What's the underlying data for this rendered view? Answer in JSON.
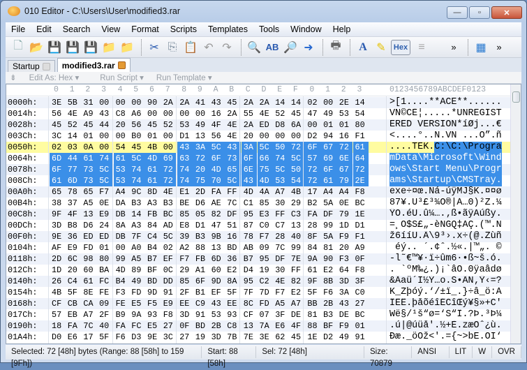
{
  "window": {
    "title": "010 Editor - C:\\Users\\User\\modified3.rar",
    "minimize": "—",
    "maximize": "▫",
    "close": "✕"
  },
  "menu": [
    "File",
    "Edit",
    "Search",
    "View",
    "Format",
    "Scripts",
    "Templates",
    "Tools",
    "Window",
    "Help"
  ],
  "toolbar": {
    "hex_label": "Hex",
    "more1": "»",
    "more2": "»"
  },
  "tabs": [
    {
      "label": "Startup"
    },
    {
      "label": "modified3.rar"
    }
  ],
  "subbar": {
    "edit_as": "Edit As: Hex ▾",
    "run_script": "Run Script ▾",
    "run_template": "Run Template ▾"
  },
  "header": {
    "hex_columns": [
      "0",
      "1",
      "2",
      "3",
      "4",
      "5",
      "6",
      "7",
      "8",
      "9",
      "A",
      "B",
      "C",
      "D",
      "E",
      "F",
      "0",
      "1",
      "2",
      "3"
    ],
    "ascii_columns": "0123456789ABCDEF0123"
  },
  "selection": {
    "start": 88,
    "end": 159,
    "cursor_row": 4
  },
  "rows": [
    {
      "addr": "0000h:",
      "hex": "3E 5B 31 00 00 00 90 2A 2A 41 43 45 2A 2A 14 14 02 00 2E 14",
      "ascii": ">[1....**ACE**......"
    },
    {
      "addr": "0014h:",
      "hex": "56 4E A9 43 C8 A6 00 00 00 00 16 2A 55 4E 52 45 47 49 53 54",
      "ascii": "VN©CÈ¦.....*UNREGIST"
    },
    {
      "addr": "0028h:",
      "hex": "45 52 45 44 20 56 45 52 53 49 4F 4E 2A ED D8 6A 00 01 01 80",
      "ascii": "ERED VERSION*íØj...€"
    },
    {
      "addr": "003Ch:",
      "hex": "3C 14 01 00 00 B0 01 00 D1 13 56 4E 20 00 00 00 D2 94 16 F1",
      "ascii": "<....°..Ñ.VN ...Ò”.ñ"
    },
    {
      "addr": "0050h:",
      "hex": "02 03 0A 00 54 45 4B 00 43 3A 5C 43 3A 5C 50 72 6F 67 72 61",
      "ascii": "....TEK.C:\\C:\\Progra"
    },
    {
      "addr": "0064h:",
      "hex": "6D 44 61 74 61 5C 4D 69 63 72 6F 73 6F 66 74 5C 57 69 6E 64",
      "ascii": "mData\\Microsoft\\Wind"
    },
    {
      "addr": "0078h:",
      "hex": "6F 77 73 5C 53 74 61 72 74 20 4D 65 6E 75 5C 50 72 6F 67 72",
      "ascii": "ows\\Start Menu\\Progr"
    },
    {
      "addr": "008Ch:",
      "hex": "61 6D 73 5C 53 74 61 72 74 75 70 5C 43 4D 53 54 72 61 79 2E",
      "ascii": "ams\\Startup\\CMSTray."
    },
    {
      "addr": "00A0h:",
      "hex": "65 78 65 F7 A4 9C 8D 4E E1 2D FA FF 4D 4A A7 4B 17 A4 A4 F8",
      "ascii": "exe÷¤œ.Ná-úÿMJ§K.¤¤ø"
    },
    {
      "addr": "00B4h:",
      "hex": "38 37 A5 0E DA B3 A3 B3 BE D6 AE 7C C1 85 30 29 B2 5A 0E BC",
      "ascii": "87¥.Ú³£³¾Ö®|Á…0)²Z.¼"
    },
    {
      "addr": "00C8h:",
      "hex": "9F 4F 13 E9 DB 14 FB BC 85 05 82 DF 95 E3 FF C3 FA DF 79 1E",
      "ascii": "ŸO.éÛ.û¼….‚ß•ãÿÃúßy."
    },
    {
      "addr": "00DCh:",
      "hex": "3D B8 D6 24 8A A3 84 AD E8 D1 47 51 87 C0 C7 13 28 99 1D D1",
      "ascii": "=¸Ö$Š£„-èÑGQ‡ÀÇ.(™.Ñ"
    },
    {
      "addr": "00F0h:",
      "hex": "9E 36 ED ED DB 7F C4 5C 39 B3 9B 16 78 F7 28 40 8F 5A F9 F1",
      "ascii": "ž6ííÛ.Ä\\9³›.x÷(@.Zùñ"
    },
    {
      "addr": "0104h:",
      "hex": "AF E9 FD 01 00 A0 B4 02 A2 88 13 BD AB 09 7C 99 84 81 20 A9",
      "ascii": "¯éý.. ´.¢ˆ.½«.|™„. ©"
    },
    {
      "addr": "0118h:",
      "hex": "2D 6C 98 80 99 A5 B7 EF F7 FB 6D 36 B7 95 DF 7E 9A 90 F3 0F",
      "ascii": "-l˜€™¥·ï÷ûm6·•ß~š.ó."
    },
    {
      "addr": "012Ch:",
      "hex": "1D 20 60 BA 4D 89 BF 0C 29 A1 60 E2 D4 19 30 FF 61 E2 64 F8",
      "ascii": ". `ºM‰¿.)¡`âÔ.0ÿaâdø"
    },
    {
      "addr": "0140h:",
      "hex": "26 C4 61 FC B4 49 BD DD 85 6F 9D 8A 95 C2 4E 82 9F 8B 3D 3F",
      "ascii": "&Äaü´I½Ý…o.Š•ÂN‚Ÿ‹=?"
    },
    {
      "addr": "0154h:",
      "hex": "4B 5F 8E FE F3 FD 9D 91 2F B1 EF 5F 7F 7D F7 E2 5F F6 3A C0",
      "ascii": "K_Žþóý.‘/±ï_.}÷â_ö:À"
    },
    {
      "addr": "0168h:",
      "hex": "CF CB CA 09 FE E5 F5 E9 EE C9 43 EE 8C FD A5 A7 BB 2B 43 27",
      "ascii": "ÏËÊ.þåõéîÉCîŒý¥§»+C'"
    },
    {
      "addr": "017Ch:",
      "hex": "57 EB A7 2F B9 9A 93 F8 3D 91 53 93 CF 07 3F DE 81 B3 DE BC",
      "ascii": "Wë§/¹š“ø=‘S“Ï.?Þ.³Þ¼"
    },
    {
      "addr": "0190h:",
      "hex": "18 FA 7C 40 FA FC E5 27 0F BD 2B C8 13 7A E6 4F 88 BF F9 01",
      "ascii": ".ú|@úüå'.½+È.zæOˆ¿ù."
    },
    {
      "addr": "01A4h:",
      "hex": "D0 E6 17 5F F6 D3 9E 3C 27 19 3D 7B 7E 3E 62 45 1E D2 49 91",
      "ascii": "Ðæ._öÓž<'.={~>bE.ÒI‘"
    }
  ],
  "status": {
    "selected": "Selected: 72 [48h] bytes (Range: 88 [58h] to 159 [9Fh])",
    "start": "Start: 88 [58h]",
    "sel": "Sel: 72 [48h]",
    "size": "Size: 70879",
    "encoding": "ANSI",
    "endian": "LIT",
    "w": "W",
    "mode": "OVR"
  },
  "colors": {
    "selection": "#3b8fe8",
    "cursor_row": "#fffca0"
  }
}
